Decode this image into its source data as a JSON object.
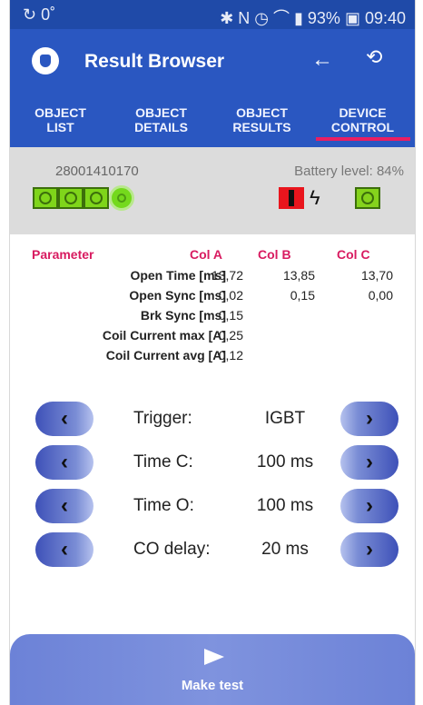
{
  "status": {
    "left": "↻ 0˚",
    "right": "✱ N ◷ ⌒ ▮ 93% ▣ 09:40"
  },
  "appbar": {
    "title": "Result Browser",
    "back_icon": "←",
    "sync_icon": "⟲"
  },
  "tabs": [
    {
      "label": "OBJECT\nLIST"
    },
    {
      "label": "OBJECT\nDETAILS"
    },
    {
      "label": "OBJECT\nRESULTS"
    },
    {
      "label": "DEVICE\nCONTROL"
    }
  ],
  "device": {
    "serial": "28001410170",
    "battery": "Battery level: 84%"
  },
  "results": {
    "headers": [
      "Parameter",
      "Col A",
      "Col B",
      "Col C"
    ],
    "rows": [
      {
        "label": "Open Time [ms]",
        "a": "13,72",
        "b": "13,85",
        "c": "13,70"
      },
      {
        "label": "Open Sync [ms]",
        "a": "0,02",
        "b": "0,15",
        "c": "0,00"
      },
      {
        "label": "Brk Sync [ms]",
        "a": "0,15",
        "b": "",
        "c": ""
      },
      {
        "label": "Coil Current max [A]",
        "a": "0,25",
        "b": "",
        "c": ""
      },
      {
        "label": "Coil Current avg [A]",
        "a": "0,12",
        "b": "",
        "c": ""
      }
    ]
  },
  "controls": [
    {
      "name": "Trigger:",
      "value": "IGBT"
    },
    {
      "name": "Time C:",
      "value": "100 ms"
    },
    {
      "name": "Time O:",
      "value": "100 ms"
    },
    {
      "name": "CO delay:",
      "value": "20 ms"
    }
  ],
  "make_test": {
    "label": "Make test"
  },
  "colors": {
    "primary": "#2a57c1",
    "accent": "#e91e63",
    "green": "#7fd51a",
    "red": "#e9151d"
  }
}
